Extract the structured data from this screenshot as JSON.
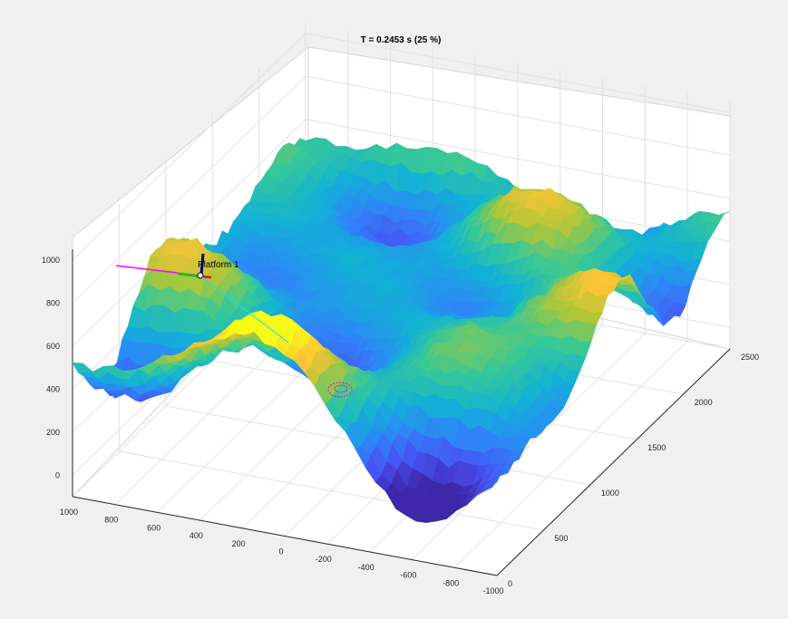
{
  "figure": {
    "title": "T = 0.2453 s (25 %)",
    "background_color": "#f0f0f0",
    "axes_color": "#ffffff"
  },
  "chart_data": {
    "type": "surface3d",
    "title": "T = 0.2453 s (25 %)",
    "colormap": "parula",
    "grid": true,
    "x_axis": {
      "ticks": [
        -1000,
        -800,
        -600,
        -400,
        -200,
        0,
        200,
        400,
        600,
        800,
        1000
      ],
      "range": [
        -1000,
        1000
      ]
    },
    "y_axis": {
      "ticks": [
        0,
        500,
        1000,
        1500,
        2000,
        2500
      ],
      "range": [
        0,
        2500
      ]
    },
    "z_axis": {
      "ticks": [
        0,
        200,
        400,
        600,
        800,
        1000
      ],
      "range": [
        -100,
        1050
      ]
    },
    "annotations": [
      {
        "text": "Platform 1"
      }
    ],
    "colors": {
      "platform_x": "#ff00ff",
      "platform_y": "#00cc00",
      "platform_z": "#000080",
      "platform_red": "#ff0000",
      "trajectory": "#00e5ff",
      "target": "#ff00ff"
    }
  }
}
